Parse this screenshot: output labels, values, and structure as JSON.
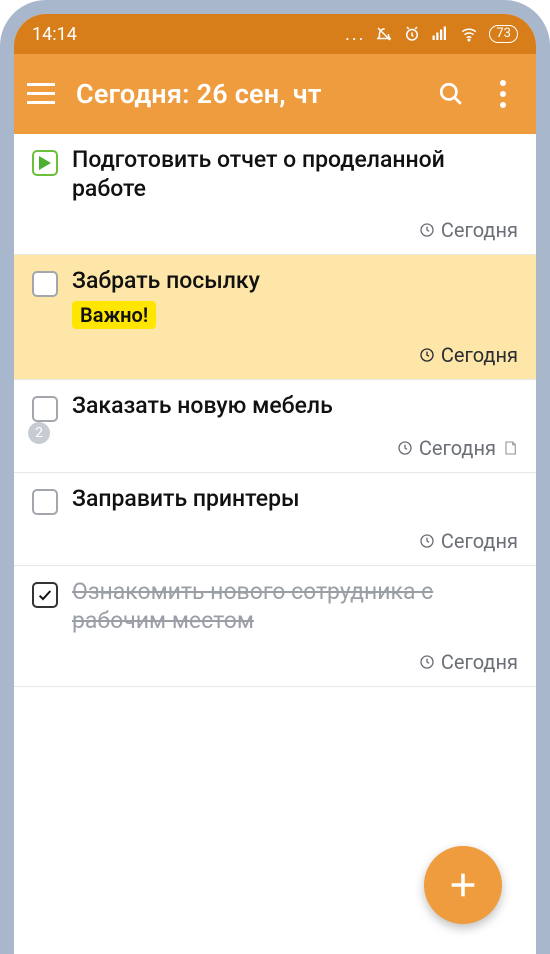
{
  "statusbar": {
    "time": "14:14",
    "battery": "73"
  },
  "appbar": {
    "title": "Сегодня: 26 сен, чт"
  },
  "tasks": [
    {
      "title": "Подготовить отчет о проделанной работе",
      "due": "Сегодня",
      "checkbox": "play",
      "highlight": false
    },
    {
      "title": "Забрать посылку",
      "tag": "Важно!",
      "due": "Сегодня",
      "checkbox": "empty",
      "highlight": true,
      "dueDark": true
    },
    {
      "title": "Заказать новую мебель",
      "due": "Сегодня",
      "checkbox": "empty",
      "subcount": "2",
      "hasNote": true
    },
    {
      "title": "Заправить принтеры",
      "due": "Сегодня",
      "checkbox": "empty"
    },
    {
      "title": "Ознакомить нового сотрудника с рабочим местом",
      "due": "Сегодня",
      "checkbox": "done",
      "struck": true
    }
  ]
}
